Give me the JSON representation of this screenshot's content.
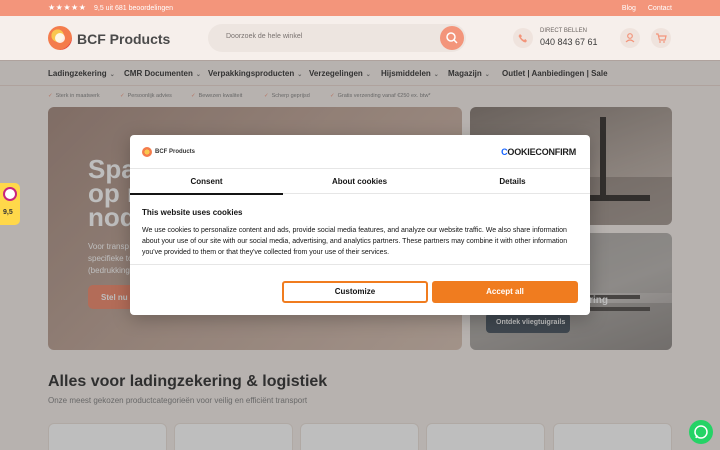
{
  "topbar": {
    "stars": "★★★★★",
    "rating_text": "9,5 uit 681 beoordelingen",
    "links": [
      "Blog",
      "Contact"
    ]
  },
  "header": {
    "brand": "BCF Products",
    "search_placeholder": "Doorzoek de hele winkel",
    "phone_label": "DIRECT BELLEN",
    "phone_number": "040 843 67 61"
  },
  "nav": {
    "items": [
      "Ladingzekering",
      "CMR Documenten",
      "Verpakkingsproducten",
      "Verzegelingen",
      "Hijsmiddelen",
      "Magazijn",
      "Outlet | Aanbiedingen | Sale"
    ]
  },
  "usps": [
    "Sterk in maatwerk",
    "Persoonlijk advies",
    "Bewezen kwaliteit",
    "Scherp geprijsd",
    "Gratis verzending vanaf €250 ex. btw*"
  ],
  "hero": {
    "title": "Spa\nop n\nnod",
    "text": "Voor transp\nspecifieke to\n(bedrukking",
    "cta": "Stel nu s",
    "side1_title": "n",
    "side2_title": "kering",
    "side2_button": "Ontdek vliegtuigrails"
  },
  "widgets": {
    "rating_score": "9,5"
  },
  "section": {
    "title": "Alles voor ladingzekering & logistiek",
    "subtitle": "Onze meest gekozen productcategorieën voor veilig en efficiënt transport"
  },
  "modal": {
    "brand": "BCF Products",
    "powered_a": "C",
    "powered_b": "OOKIECONFIRM",
    "tabs": [
      "Consent",
      "About cookies",
      "Details"
    ],
    "title": "This website uses cookies",
    "text": "We use cookies to personalize content and ads, provide social media features, and analyze our website traffic. We also share information about your use of our site with our social media, advertising, and analytics partners. These partners may combine it with other information you've provided to them or that they've collected from your use of their services.",
    "customize": "Customize",
    "accept": "Accept all"
  },
  "colors": {
    "accent": "#f3957b",
    "accept": "#f07c1f",
    "whatsapp": "#25d366"
  }
}
